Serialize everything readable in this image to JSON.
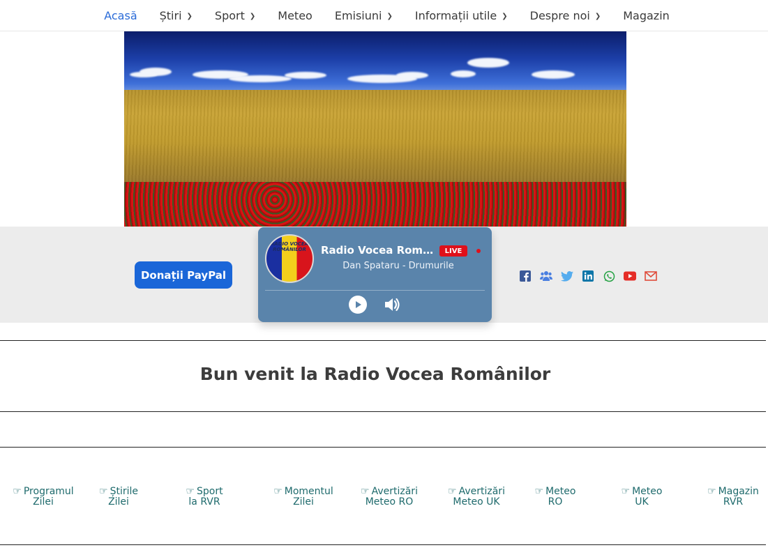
{
  "nav": {
    "items": [
      {
        "label": "Acasă",
        "active": true,
        "dropdown": false
      },
      {
        "label": "Știri",
        "active": false,
        "dropdown": true
      },
      {
        "label": "Sport",
        "active": false,
        "dropdown": true
      },
      {
        "label": "Meteo",
        "active": false,
        "dropdown": false
      },
      {
        "label": "Emisiuni",
        "active": false,
        "dropdown": true
      },
      {
        "label": "Informații utile",
        "active": false,
        "dropdown": true
      },
      {
        "label": "Despre noi",
        "active": false,
        "dropdown": true
      },
      {
        "label": "Magazin",
        "active": false,
        "dropdown": false
      }
    ]
  },
  "donate": {
    "label": "Donații PayPal"
  },
  "player": {
    "logo_text": "RADIO VOCEA ROMÂNILOR",
    "station": "Radio Vocea Românilor",
    "live_label": "LIVE",
    "track": "Dan Spataru - Drumurile"
  },
  "social": {
    "icons": [
      "facebook-icon",
      "users-group-icon",
      "twitter-icon",
      "linkedin-icon",
      "whatsapp-icon",
      "youtube-icon",
      "email-icon"
    ],
    "colors": {
      "facebook": "#3b5998",
      "group": "#4a7fe0",
      "twitter": "#55acee",
      "linkedin": "#0e76a8",
      "whatsapp": "#25a244",
      "youtube": "#e52d27",
      "email": "#e04b3a"
    }
  },
  "welcome": {
    "title": "Bun venit la Radio Vocea Românilor"
  },
  "quick_links": [
    "Programul Zilei",
    "Știrile Zilei",
    "Sport la RVR",
    "Momentul Zilei",
    "Avertizări Meteo RO",
    "Avertizări Meteo UK",
    "Meteo RO",
    "Meteo UK",
    "Magazin RVR"
  ],
  "colors": {
    "accent": "#2a6bd8",
    "link": "#1e6a6c",
    "player_bg": "#5a84ab",
    "live": "#e0101a"
  }
}
